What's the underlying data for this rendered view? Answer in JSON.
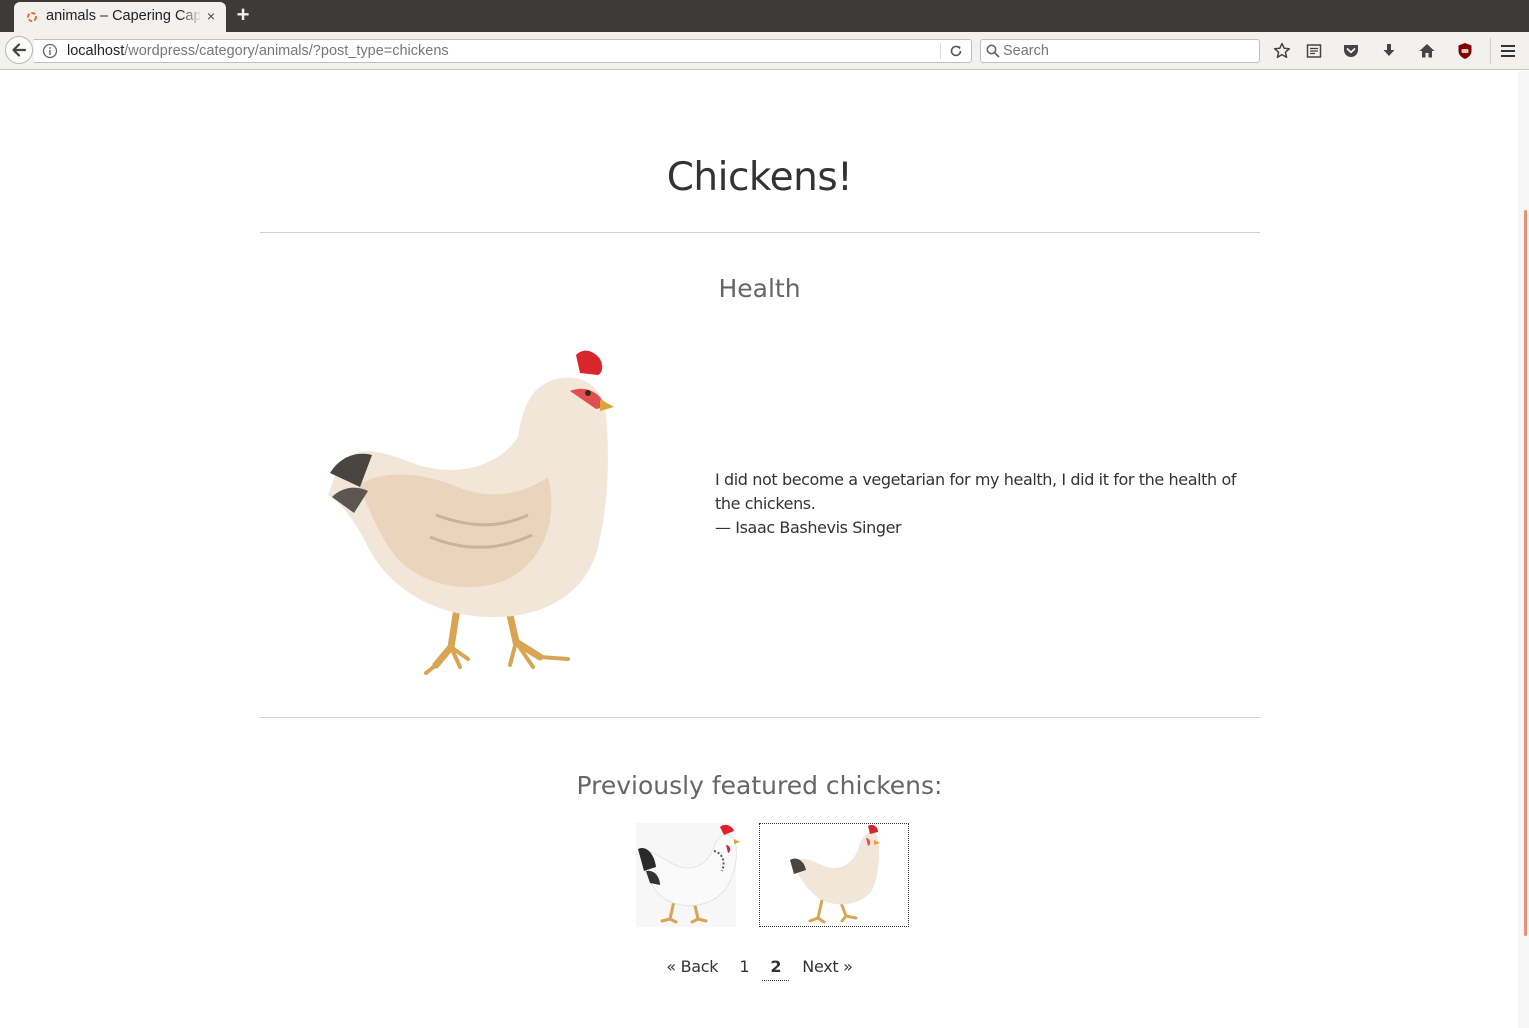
{
  "browser": {
    "tab_title": "animals – Capering Capricorns",
    "tab_close": "×",
    "new_tab": "+",
    "url_host": "localhost",
    "url_path": "/wordpress/category/animals/?post_type=chickens",
    "search_placeholder": "Search",
    "toolbar_icons": [
      "bookmark-star-icon",
      "reader-view-icon",
      "pocket-icon",
      "download-icon",
      "home-icon",
      "ublock-icon",
      "hamburger-menu-icon"
    ],
    "accent_color": "#e8906f"
  },
  "page": {
    "title": "Chickens!",
    "post": {
      "title": "Health",
      "quote_text": "I did not become a vegetarian for my health, I did it for the health of the chickens.",
      "quote_author": "— Isaac Bashevis Singer",
      "image": "hen-photo"
    },
    "previous": {
      "heading": "Previously featured chickens:",
      "thumbnails": [
        {
          "image": "white-hen-photo",
          "selected": false
        },
        {
          "image": "buff-hen-photo",
          "selected": true
        }
      ]
    },
    "pagination": {
      "back": "« Back",
      "pages": [
        "1",
        "2"
      ],
      "current": "2",
      "next": "Next »"
    }
  }
}
